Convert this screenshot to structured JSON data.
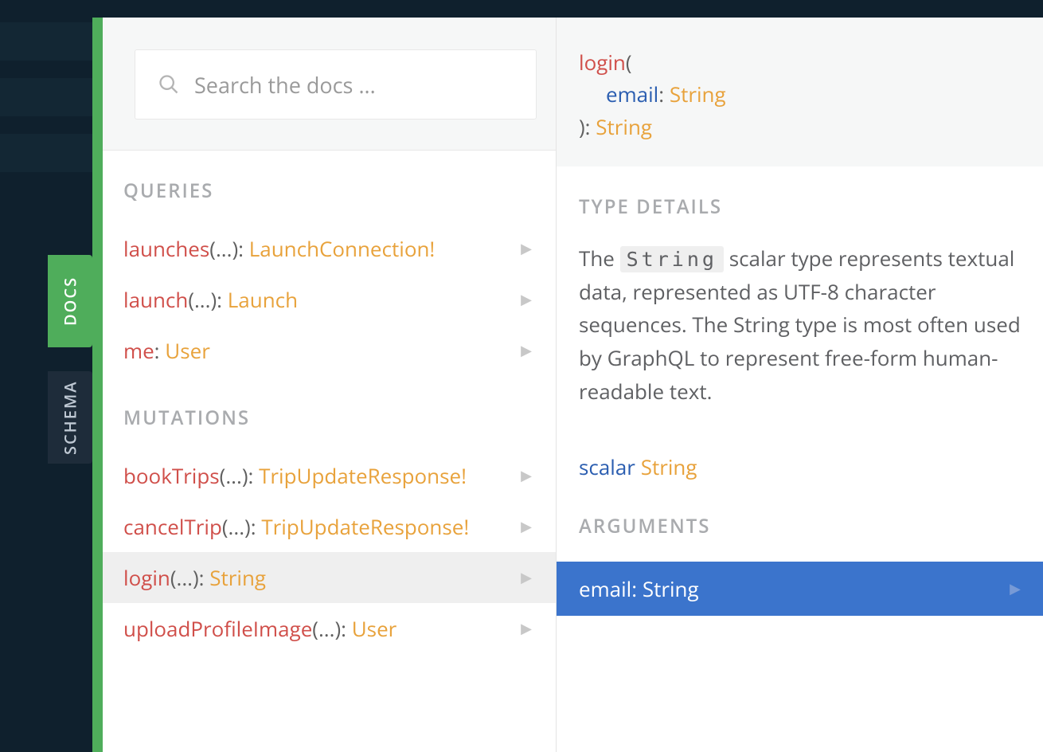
{
  "sideTabs": {
    "docs": "DOCS",
    "schema": "SCHEMA"
  },
  "search": {
    "placeholder": "Search the docs ..."
  },
  "sections": {
    "queries": {
      "title": "QUERIES",
      "items": [
        {
          "fn": "launches",
          "args": "(...)",
          "type": "LaunchConnection!"
        },
        {
          "fn": "launch",
          "args": "(...)",
          "type": "Launch"
        },
        {
          "fn": "me",
          "args": "",
          "type": "User"
        }
      ]
    },
    "mutations": {
      "title": "MUTATIONS",
      "items": [
        {
          "fn": "bookTrips",
          "args": "(...)",
          "type": "TripUpdateResponse!"
        },
        {
          "fn": "cancelTrip",
          "args": "(...)",
          "type": "TripUpdateResponse!"
        },
        {
          "fn": "login",
          "args": "(...)",
          "type": "String",
          "selected": true
        },
        {
          "fn": "uploadProfileImage",
          "args": "(...)",
          "type": "User"
        }
      ]
    }
  },
  "detail": {
    "signature": {
      "fn": "login",
      "open": "(",
      "param": "email",
      "paramSep": ": ",
      "paramType": "String",
      "close": "): ",
      "returnType": "String"
    },
    "typeDetailsTitle": "TYPE DETAILS",
    "desc_pre": "The ",
    "desc_code": "String",
    "desc_post": " scalar type represents textual data, represented as UTF-8 character sequences. The String type is most often used by GraphQL to represent free-form human-readable text.",
    "scalar_kw": "scalar",
    "scalar_type": "String",
    "argumentsTitle": "ARGUMENTS",
    "argument": {
      "name": "email",
      "sep": ": ",
      "type": "String"
    }
  }
}
